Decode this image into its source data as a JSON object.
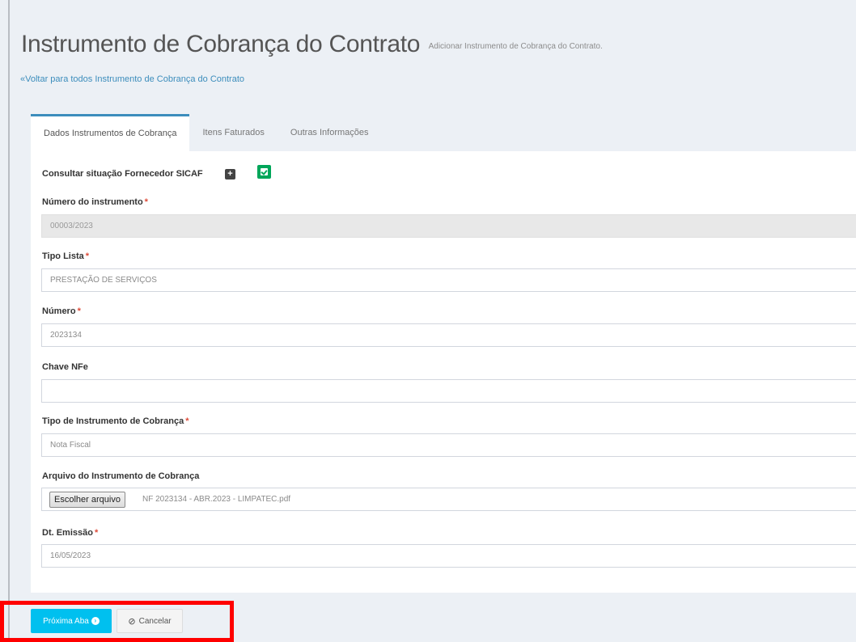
{
  "header": {
    "title": "Instrumento de Cobrança do Contrato",
    "subtitle": "Adicionar Instrumento de Cobrança do Contrato.",
    "back_link": "«Voltar para todos Instrumento de Cobrança do Contrato"
  },
  "tabs": [
    {
      "label": "Dados Instrumentos de Cobrança",
      "active": true
    },
    {
      "label": "Itens Faturados",
      "active": false
    },
    {
      "label": "Outras Informações",
      "active": false
    }
  ],
  "form": {
    "sicaf_label": "Consultar situação Fornecedor SICAF",
    "sicaf_plus_icon": "+",
    "required_mark": "*",
    "numero_instrumento": {
      "label": "Número do instrumento",
      "value": "00003/2023"
    },
    "tipo_lista": {
      "label": "Tipo Lista",
      "value": "PRESTAÇÃO DE SERVIÇOS"
    },
    "numero": {
      "label": "Número",
      "value": "2023134"
    },
    "chave_nfe": {
      "label": "Chave NFe",
      "value": ""
    },
    "tipo_instrumento": {
      "label": "Tipo de Instrumento de Cobrança",
      "value": "Nota Fiscal"
    },
    "arquivo": {
      "label": "Arquivo do Instrumento de Cobrança",
      "button": "Escolher arquivo",
      "filename": "NF 2023134 - ABR.2023 - LIMPATEC.pdf"
    },
    "dt_emissao": {
      "label": "Dt. Emissão",
      "value": "16/05/2023"
    }
  },
  "actions": {
    "next_label": "Próxima Aba",
    "next_icon": "›",
    "cancel_icon": "⊘",
    "cancel_label": "Cancelar"
  },
  "colors": {
    "primary": "#3c8dbc",
    "info": "#00c0ef",
    "success": "#00a65a",
    "required": "#dd4b39",
    "highlight": "#ff0000"
  }
}
